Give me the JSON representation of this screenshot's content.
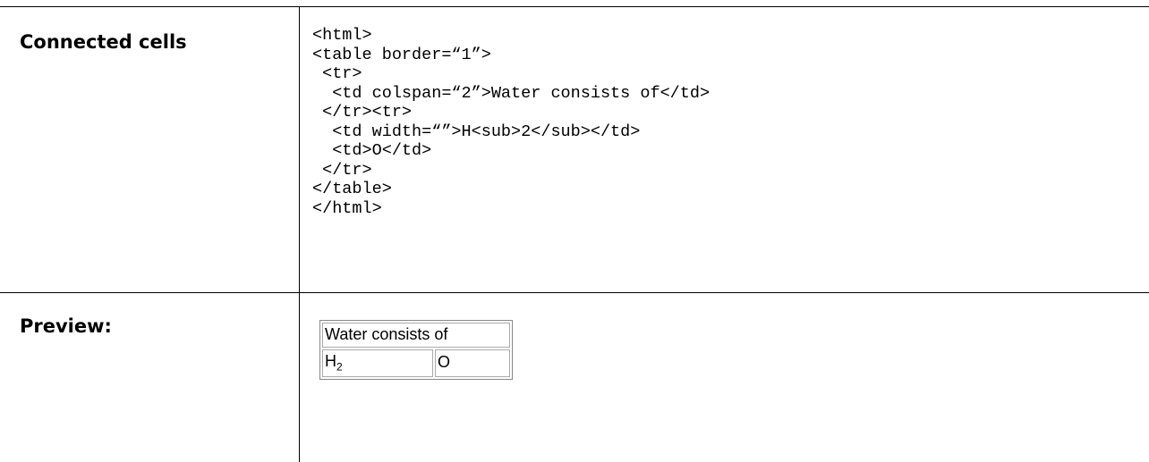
{
  "code_section": {
    "label": "Connected cells",
    "code": "<html>\n<table border=“1”>\n <tr>\n  <td colspan=“2”>Water consists of</td>\n </tr><tr>\n  <td width=“”>H<sub>2</sub></td>\n  <td>O</td>\n </tr>\n</table>\n</html>"
  },
  "preview_section": {
    "label": "Preview:",
    "table": {
      "header_cell": "Water consists of",
      "cell_h": "H",
      "cell_h_sub": "2",
      "cell_o": "O"
    }
  }
}
